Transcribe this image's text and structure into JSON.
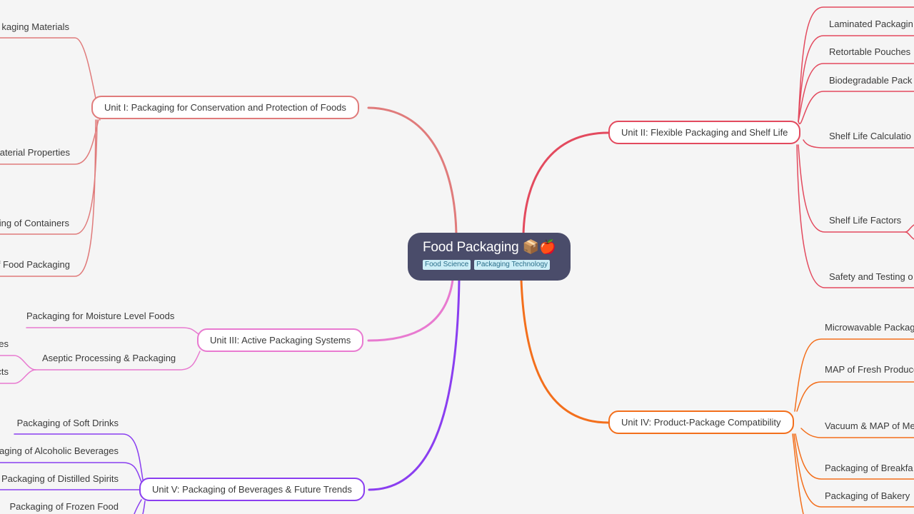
{
  "root": {
    "title": "Food Packaging 📦🍎",
    "tags": [
      "Food Science",
      "Packaging Technology"
    ],
    "color": "#4a4c6a"
  },
  "units": [
    {
      "label": "Unit I: Packaging for Conservation and Protection of Foods",
      "color": "#e07b7b",
      "children": [
        "Packaging Materials",
        "Material Properties",
        "Testing of Containers",
        "Laws of Food Packaging"
      ],
      "visible_children": [
        "kaging Materials",
        "aterial Properties",
        "ing of Containers",
        "f Food Packaging"
      ]
    },
    {
      "label": "Unit II: Flexible Packaging and Shelf Life",
      "color": "#e34a5e",
      "children": [
        "Laminated Packaging",
        "Retortable Pouches",
        "Biodegradable Packaging",
        "Shelf Life Calculation",
        "Shelf Life Factors",
        "Safety and Testing of Packaging"
      ],
      "visible_children": [
        "Laminated Packagin",
        "Retortable Pouches",
        "Biodegradable Pack",
        "Shelf Life Calculatio",
        "Shelf Life Factors",
        "Safety and Testing o"
      ]
    },
    {
      "label": "Unit III: Active Packaging Systems",
      "color": "#e87ad0",
      "children": [
        "Packaging for Moisture Level Foods",
        "Aseptic Processing & Packaging"
      ],
      "grandchildren": [
        "es",
        "cts"
      ]
    },
    {
      "label": "Unit IV: Product-Package Compatibility",
      "color": "#f36f1c",
      "children": [
        "Microwavable Packaging",
        "MAP of Fresh Produce",
        "Vacuum & MAP of Meat",
        "Packaging of Breakfast",
        "Packaging of Bakery"
      ],
      "visible_children": [
        "Microwavable Packag",
        "MAP of Fresh Produce",
        "Vacuum & MAP of Me",
        "Packaging of Breakfa",
        "Packaging of Bakery"
      ]
    },
    {
      "label": "Unit V: Packaging of Beverages & Future Trends",
      "color": "#8a3ef0",
      "children": [
        "Packaging of Soft Drinks",
        "Packaging of Alcoholic Beverages",
        "Packaging of Distilled Spirits",
        "Packaging of Frozen Food"
      ],
      "visible_children": [
        "Packaging of Soft Drinks",
        "aging of Alcoholic Beverages",
        "Packaging of Distilled Spirits",
        "Packaging of Frozen Food"
      ]
    }
  ]
}
